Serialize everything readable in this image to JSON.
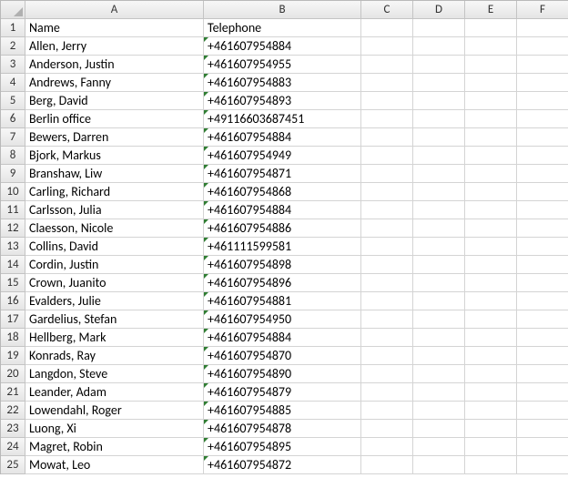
{
  "columns": [
    "A",
    "B",
    "C",
    "D",
    "E",
    "F"
  ],
  "row_start": 1,
  "row_end": 25,
  "headers": {
    "A": "Name",
    "B": "Telephone"
  },
  "rows": [
    {
      "n": 2,
      "A": "Allen, Jerry",
      "B": "+461607954884"
    },
    {
      "n": 3,
      "A": "Anderson, Justin",
      "B": "+461607954955"
    },
    {
      "n": 4,
      "A": "Andrews, Fanny",
      "B": "+461607954883"
    },
    {
      "n": 5,
      "A": "Berg, David",
      "B": "+461607954893"
    },
    {
      "n": 6,
      "A": "Berlin office",
      "B": "+49116603687451"
    },
    {
      "n": 7,
      "A": "Bewers, Darren",
      "B": "+461607954884"
    },
    {
      "n": 8,
      "A": "Bjork, Markus",
      "B": "+461607954949"
    },
    {
      "n": 9,
      "A": "Branshaw, Liw",
      "B": "+461607954871"
    },
    {
      "n": 10,
      "A": "Carling, Richard",
      "B": "+461607954868"
    },
    {
      "n": 11,
      "A": "Carlsson, Julia",
      "B": "+461607954884"
    },
    {
      "n": 12,
      "A": "Claesson, Nicole",
      "B": "+461607954886"
    },
    {
      "n": 13,
      "A": "Collins, David",
      "B": "+461111599581"
    },
    {
      "n": 14,
      "A": "Cordin, Justin",
      "B": "+461607954898"
    },
    {
      "n": 15,
      "A": "Crown, Juanito",
      "B": "+461607954896"
    },
    {
      "n": 16,
      "A": "Evalders, Julie",
      "B": "+461607954881"
    },
    {
      "n": 17,
      "A": "Gardelius, Stefan",
      "B": "+461607954950"
    },
    {
      "n": 18,
      "A": "Hellberg, Mark",
      "B": "+461607954884"
    },
    {
      "n": 19,
      "A": "Konrads, Ray",
      "B": "+461607954870"
    },
    {
      "n": 20,
      "A": "Langdon, Steve",
      "B": "+461607954890"
    },
    {
      "n": 21,
      "A": "Leander, Adam",
      "B": "+461607954879"
    },
    {
      "n": 22,
      "A": "Lowendahl, Roger",
      "B": "+461607954885"
    },
    {
      "n": 23,
      "A": "Luong, Xi",
      "B": "+461607954878"
    },
    {
      "n": 24,
      "A": "Magret, Robin",
      "B": "+461607954895"
    },
    {
      "n": 25,
      "A": "Mowat, Leo",
      "B": "+461607954872"
    }
  ],
  "chart_data": {
    "type": "table",
    "title": "",
    "columns": [
      "Name",
      "Telephone"
    ],
    "data": [
      [
        "Allen, Jerry",
        "+461607954884"
      ],
      [
        "Anderson, Justin",
        "+461607954955"
      ],
      [
        "Andrews, Fanny",
        "+461607954883"
      ],
      [
        "Berg, David",
        "+461607954893"
      ],
      [
        "Berlin office",
        "+49116603687451"
      ],
      [
        "Bewers, Darren",
        "+461607954884"
      ],
      [
        "Bjork, Markus",
        "+461607954949"
      ],
      [
        "Branshaw, Liw",
        "+461607954871"
      ],
      [
        "Carling, Richard",
        "+461607954868"
      ],
      [
        "Carlsson, Julia",
        "+461607954884"
      ],
      [
        "Claesson, Nicole",
        "+461607954886"
      ],
      [
        "Collins, David",
        "+461111599581"
      ],
      [
        "Cordin, Justin",
        "+461607954898"
      ],
      [
        "Crown, Juanito",
        "+461607954896"
      ],
      [
        "Evalders, Julie",
        "+461607954881"
      ],
      [
        "Gardelius, Stefan",
        "+461607954950"
      ],
      [
        "Hellberg, Mark",
        "+461607954884"
      ],
      [
        "Konrads, Ray",
        "+461607954870"
      ],
      [
        "Langdon, Steve",
        "+461607954890"
      ],
      [
        "Leander, Adam",
        "+461607954879"
      ],
      [
        "Lowendahl, Roger",
        "+461607954885"
      ],
      [
        "Luong, Xi",
        "+461607954878"
      ],
      [
        "Magret, Robin",
        "+461607954895"
      ],
      [
        "Mowat, Leo",
        "+461607954872"
      ]
    ]
  }
}
